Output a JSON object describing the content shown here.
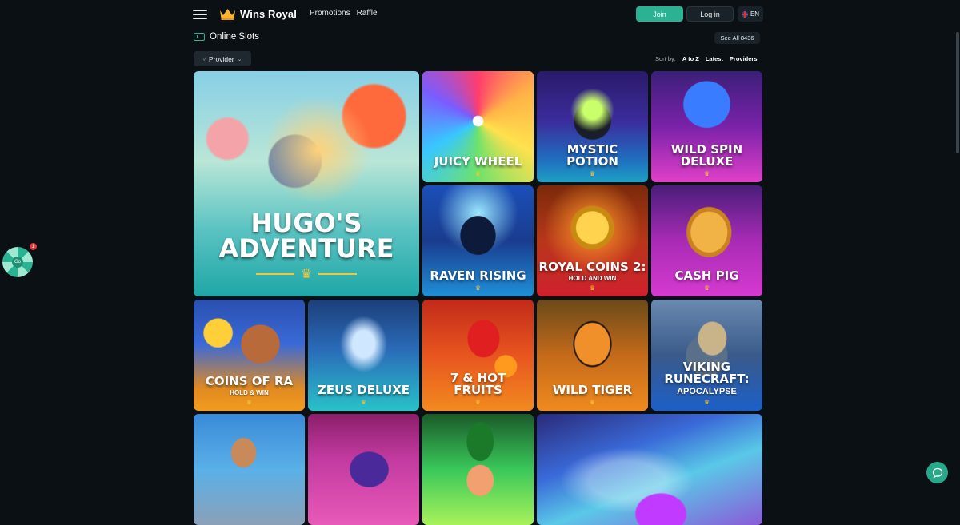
{
  "header": {
    "brand": "Wins Royal",
    "nav": [
      "Promotions",
      "Raffle"
    ],
    "join_label": "Join",
    "login_label": "Log in",
    "language": "EN"
  },
  "section": {
    "title": "Online Slots",
    "see_all": "See All 8436",
    "provider_label": "Provider",
    "sort_label": "Sort by:",
    "sort_options": [
      "A to Z",
      "Latest",
      "Providers"
    ]
  },
  "games": [
    {
      "name": "Hugo's Adventure",
      "subtitle": ""
    },
    {
      "name": "Juicy Wheel",
      "subtitle": ""
    },
    {
      "name": "Mystic Potion",
      "subtitle": ""
    },
    {
      "name": "Wild Spin Deluxe",
      "subtitle": ""
    },
    {
      "name": "Raven Rising",
      "subtitle": ""
    },
    {
      "name": "Royal Coins 2:",
      "subtitle": "Hold and Win"
    },
    {
      "name": "Cash Pig",
      "subtitle": ""
    },
    {
      "name": "Coins of Ra",
      "subtitle": "Hold & Win"
    },
    {
      "name": "Zeus Deluxe",
      "subtitle": ""
    },
    {
      "name": "7 & Hot Fruits",
      "subtitle": ""
    },
    {
      "name": "Wild Tiger",
      "subtitle": ""
    },
    {
      "name": "Viking Runecraft:",
      "subtitle": "Apocalypse"
    },
    {
      "name": "",
      "subtitle": ""
    },
    {
      "name": "",
      "subtitle": ""
    },
    {
      "name": "",
      "subtitle": ""
    },
    {
      "name": "",
      "subtitle": ""
    }
  ],
  "widgets": {
    "wheel_label": "Go",
    "notification_count": "1"
  },
  "colors": {
    "background": "#0b1015",
    "accent": "#2bb292",
    "crown": "#f5c53a"
  }
}
